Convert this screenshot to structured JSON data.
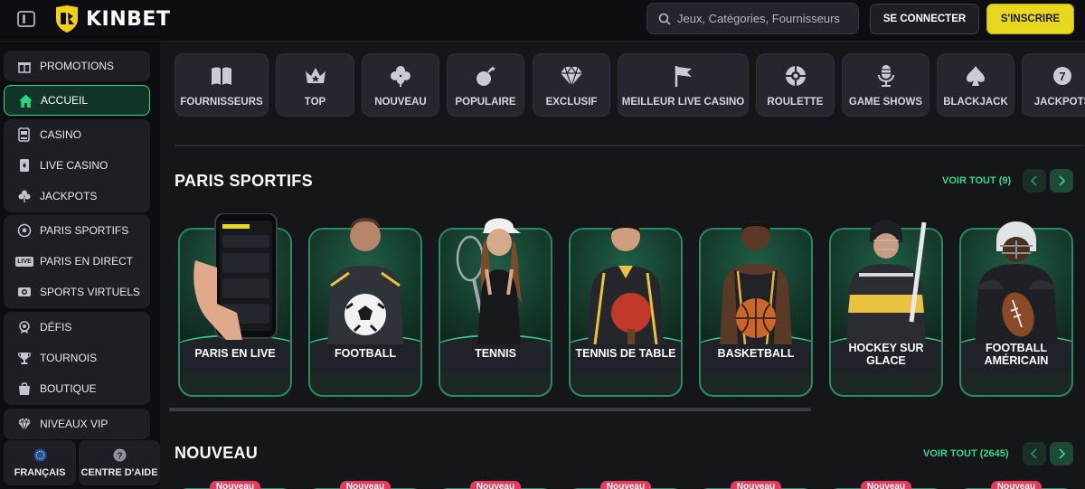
{
  "header": {
    "brand": "KINBET",
    "search_placeholder": "Jeux, Catégories, Fournisseurs",
    "login_label": "SE CONNECTER",
    "signup_label": "S'INSCRIRE"
  },
  "sidebar": {
    "items": [
      {
        "label": "PROMOTIONS",
        "icon": "gift-icon"
      },
      {
        "label": "ACCUEIL",
        "icon": "home-icon",
        "active": true
      },
      {
        "label": "CASINO",
        "icon": "slot-machine-icon"
      },
      {
        "label": "LIVE CASINO",
        "icon": "card-icon"
      },
      {
        "label": "JACKPOTS",
        "icon": "clover-icon"
      },
      {
        "label": "PARIS SPORTIFS",
        "icon": "soccer-ball-icon"
      },
      {
        "label": "PARIS EN DIRECT",
        "icon": "live-icon"
      },
      {
        "label": "SPORTS VIRTUELS",
        "icon": "virtual-sports-icon"
      },
      {
        "label": "DÉFIS",
        "icon": "medal-icon"
      },
      {
        "label": "TOURNOIS",
        "icon": "trophy-icon"
      },
      {
        "label": "BOUTIQUE",
        "icon": "shopping-bag-icon"
      },
      {
        "label": "NIVEAUX VIP",
        "icon": "diamond-icon"
      }
    ],
    "live_badge": "LIVE",
    "language": "FRANÇAIS",
    "help": "CENTRE D'AIDE"
  },
  "categories": [
    {
      "label": "FOURNISSEURS",
      "icon": "book-icon"
    },
    {
      "label": "TOP",
      "icon": "crown-icon"
    },
    {
      "label": "NOUVEAU",
      "icon": "clover-icon"
    },
    {
      "label": "POPULAIRE",
      "icon": "bomb-icon"
    },
    {
      "label": "EXCLUSIF",
      "icon": "diamond-icon"
    },
    {
      "label": "MEILLEUR LIVE CASINO",
      "icon": "flag-icon"
    },
    {
      "label": "ROULETTE",
      "icon": "roulette-icon"
    },
    {
      "label": "GAME SHOWS",
      "icon": "microphone-icon"
    },
    {
      "label": "BLACKJACK",
      "icon": "spade-icon"
    },
    {
      "label": "JACKPOTS",
      "icon": "jackpot-icon"
    }
  ],
  "sports_section": {
    "title": "PARIS SPORTIFS",
    "see_all": "VOIR TOUT (9)",
    "cards": [
      {
        "label": "PARIS EN LIVE"
      },
      {
        "label": "FOOTBALL"
      },
      {
        "label": "TENNIS"
      },
      {
        "label": "TENNIS DE TABLE"
      },
      {
        "label": "BASKETBALL"
      },
      {
        "label": "HOCKEY SUR GLACE"
      },
      {
        "label": "FOOTBALL AMÉRICAIN"
      }
    ]
  },
  "new_section": {
    "title": "NOUVEAU",
    "see_all": "VOIR TOUT (2645)",
    "badge": "Nouveau"
  },
  "colors": {
    "accent_green": "#2dd783",
    "signup_yellow": "#e8d71f",
    "badge_red": "#e43c5c",
    "background": "#15161a"
  }
}
